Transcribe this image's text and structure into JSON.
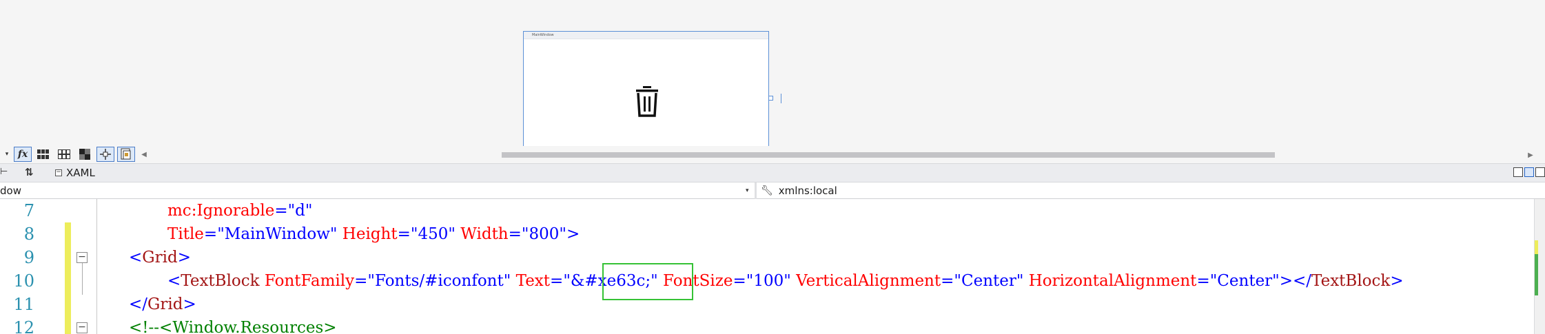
{
  "designer": {
    "preview_window_title": "MainWindow",
    "icon_glyph": "trash-icon"
  },
  "toolbar": {
    "fx_label": "fx"
  },
  "tabs": {
    "xaml_label": "XAML",
    "collapse_symbol": "⊟"
  },
  "navbar": {
    "left_text": "dow",
    "right_text": "xmlns:local"
  },
  "editor": {
    "lines": [
      {
        "num": "7"
      },
      {
        "num": "8"
      },
      {
        "num": "9"
      },
      {
        "num": "10"
      },
      {
        "num": "11"
      },
      {
        "num": "12"
      }
    ],
    "tokens": {
      "l7_attr": "mc:Ignorable",
      "l7_eq": "=",
      "l7_val": "\"d\"",
      "l8_attr1": "Title",
      "l8_eq1": "=",
      "l8_val1": "\"MainWindow\"",
      "l8_attr2": "Height",
      "l8_eq2": "=",
      "l8_val2": "\"450\"",
      "l8_attr3": "Width",
      "l8_eq3": "=",
      "l8_val3": "\"800\"",
      "l8_close": ">",
      "l9_open": "<",
      "l9_tag": "Grid",
      "l9_close": ">",
      "l10_open": "<",
      "l10_tag": "TextBlock",
      "l10_attr1": "FontFamily",
      "l10_eq1": "=",
      "l10_val1": "\"Fonts/#iconfont\"",
      "l10_attr2": "Text",
      "l10_eq2": "=",
      "l10_val2": "\"&#xe63c;\"",
      "l10_attr3": "FontSize",
      "l10_eq3": "=",
      "l10_val3": "\"100\"",
      "l10_attr4": "VerticalAlignment",
      "l10_eq4": "=",
      "l10_val4": "\"Center\"",
      "l10_attr5": "HorizontalAlignment",
      "l10_eq5": "=",
      "l10_val5": "\"Center\"",
      "l10_close": "></",
      "l10_tag2": "TextBlock",
      "l10_close2": ">",
      "l11_open": "</",
      "l11_tag": "Grid",
      "l11_close": ">",
      "l12_comment": "<!--<Window.Resources>"
    }
  },
  "colors": {
    "keyword_blue": "#0000ff",
    "attribute_red": "#ff0000",
    "element_brown": "#a31515",
    "comment_green": "#008000",
    "line_number": "#2b91af",
    "highlight_box": "#35c235",
    "change_bar": "#eded5b"
  }
}
